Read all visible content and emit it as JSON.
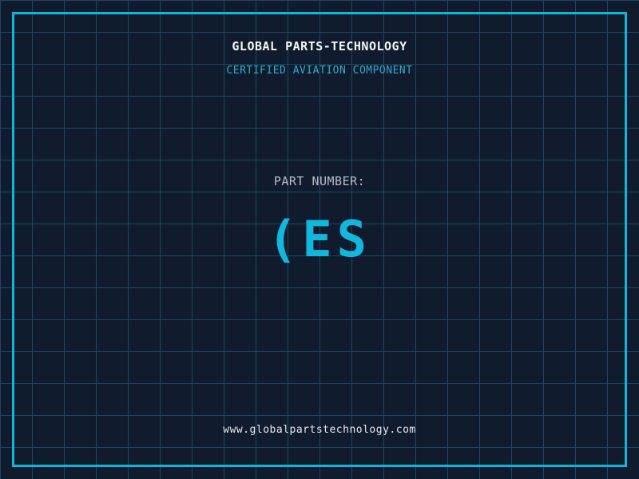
{
  "header": {
    "title": "GLOBAL PARTS-TECHNOLOGY",
    "subtitle": "CERTIFIED AVIATION COMPONENT"
  },
  "part": {
    "label": "PART NUMBER:",
    "value": "(ES"
  },
  "footer": {
    "url": "www.globalpartstechnology.com"
  },
  "colors": {
    "background": "#101b2d",
    "grid_line": "#1c4962",
    "frame": "#10b5da",
    "title_text": "#f4f6f7",
    "subtitle_text": "#32a9cf",
    "label_text": "#b6bfc7",
    "part_value_text": "#12b7dd",
    "footer_text": "#e4e8ea"
  }
}
